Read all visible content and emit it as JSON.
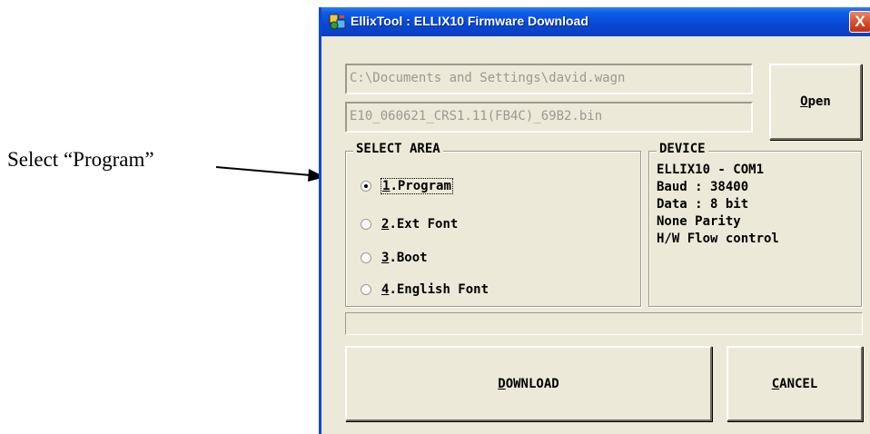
{
  "annotation": {
    "text": "Select “Program”"
  },
  "window": {
    "title": "EllixTool : ELLIX10 Firmware Download",
    "close_label": "X",
    "app_icon": "ellixtool-app-icon"
  },
  "file": {
    "path_value": "C:\\Documents and Settings\\david.wagn",
    "filename_value": "E10_060621_CRS1.11(FB4C)_69B2.bin"
  },
  "buttons": {
    "open": {
      "mnemonic": "O",
      "rest": "pen"
    },
    "download": {
      "mnemonic": "D",
      "rest": "OWNLOAD"
    },
    "cancel": {
      "mnemonic": "C",
      "rest": "ANCEL"
    }
  },
  "select_area": {
    "title": "SELECT AREA",
    "selected": "1.Program",
    "options": [
      {
        "mnemonic": "1",
        "rest": ".Program",
        "checked": true
      },
      {
        "mnemonic": "2",
        "rest": ".Ext Font",
        "checked": false
      },
      {
        "mnemonic": "3",
        "rest": ".Boot",
        "checked": false
      },
      {
        "mnemonic": "4",
        "rest": ".English Font",
        "checked": false
      }
    ]
  },
  "device": {
    "title": "DEVICE",
    "lines": [
      "ELLIX10 - COM1",
      "Baud : 38400",
      "Data : 8 bit",
      "None Parity",
      "H/W Flow control"
    ]
  },
  "progress": {
    "value": 0
  },
  "colors": {
    "window_bg": "#ece9d8",
    "titlebar": "#0a46d8",
    "close": "#d1492a"
  }
}
